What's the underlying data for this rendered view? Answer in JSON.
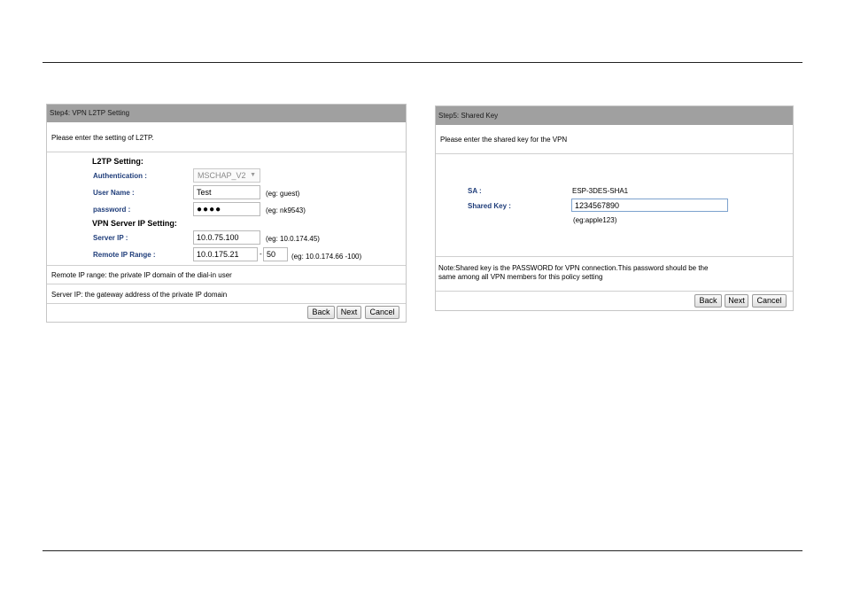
{
  "l2tp": {
    "title": "Step4: VPN L2TP Setting",
    "intro": "Please enter the setting of L2TP.",
    "section_l2tp": "L2TP Setting:",
    "auth_label": "Authentication :",
    "auth_value": "MSCHAP_V2",
    "user_label": "User Name :",
    "user_value": "Test",
    "user_hint": "(eg: guest)",
    "pw_label": "password :",
    "pw_value": "●●●●",
    "pw_hint": "(eg: nk9543)",
    "section_server": "VPN Server IP Setting:",
    "server_label": "Server IP :",
    "server_value": "10.0.75.100",
    "server_hint": "(eg: 10.0.174.45)",
    "range_label": "Remote IP Range :",
    "range_start": "10.0.175.21",
    "range_dash": "-",
    "range_end": "50",
    "range_hint": "(eg: 10.0.174.66 -100)",
    "note1": "Remote IP range: the private IP domain of the dial-in user",
    "note2": "Server IP: the gateway address of the private IP domain",
    "buttons": {
      "back": "Back",
      "next": "Next",
      "cancel": "Cancel"
    }
  },
  "shared_key": {
    "title": "Step5: Shared Key",
    "intro": "Please enter the shared key for the VPN",
    "sa_label": "SA :",
    "sa_value": "ESP-3DES-SHA1",
    "key_label": "Shared Key :",
    "key_value": "1234567890",
    "key_hint": "(eg:apple123)",
    "note_line1": "Note:Shared key is the PASSWORD for VPN connection.This password should be the",
    "note_line2": "same among all VPN members for this policy setting",
    "buttons": {
      "back": "Back",
      "next": "Next",
      "cancel": "Cancel"
    }
  }
}
